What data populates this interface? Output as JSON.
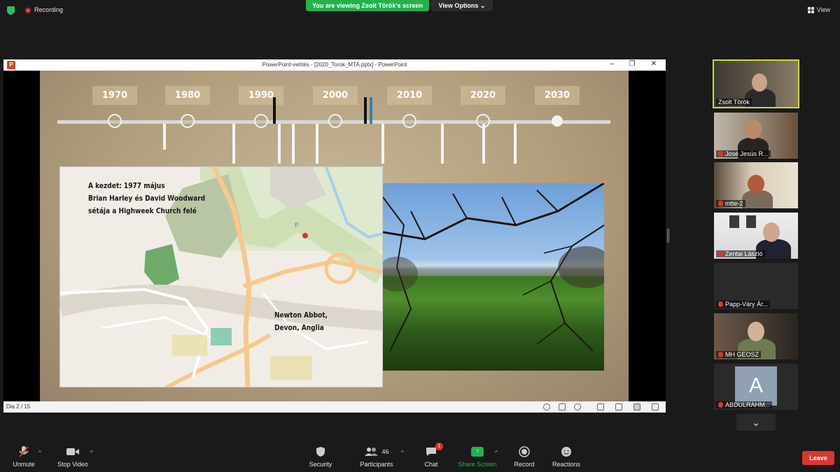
{
  "top_bar": {
    "recording_label": "Recording",
    "viewing_banner": "You are viewing Zsolt Török's screen",
    "view_options_label": "View Options",
    "view_label": "View"
  },
  "powerpoint": {
    "window_title": "PowerPoint-vetítés - [2020_Torok_MTA.pptx] - PowerPoint",
    "slide_counter": "Dia 2 / 15",
    "timeline_years": [
      "1970",
      "1980",
      "1990",
      "2000",
      "2010",
      "2020",
      "2030"
    ],
    "map_caption_lines": [
      "A kezdet: 1977 május",
      "Brian Harley és David Woodward",
      "sétája a Highweek Church felé"
    ],
    "location_caption_lines": [
      "Newton Abbot,",
      "Devon, Anglia"
    ]
  },
  "participants": [
    {
      "name": "Zsolt Török",
      "muted": false,
      "active": true
    },
    {
      "name": "José Jesús R...",
      "muted": true
    },
    {
      "name": "mtte-2",
      "muted": true
    },
    {
      "name": "Zentai László",
      "muted": true
    },
    {
      "name": "Papp-Váry Ár...",
      "muted": true
    },
    {
      "name": "MH GEOSZ",
      "muted": true
    },
    {
      "name": "ABDULRAHM...",
      "muted": true,
      "avatar_letter": "A"
    }
  ],
  "toolbar": {
    "unmute_label": "Unmute",
    "stop_video_label": "Stop Video",
    "security_label": "Security",
    "participants_label": "Participants",
    "participants_count": "46",
    "chat_label": "Chat",
    "chat_badge": "1",
    "share_screen_label": "Share Screen",
    "record_label": "Record",
    "reactions_label": "Reactions",
    "leave_label": "Leave"
  },
  "colors": {
    "accent_green": "#23b34a",
    "leave_red": "#d9372d",
    "active_speaker": "#c7e02a"
  }
}
